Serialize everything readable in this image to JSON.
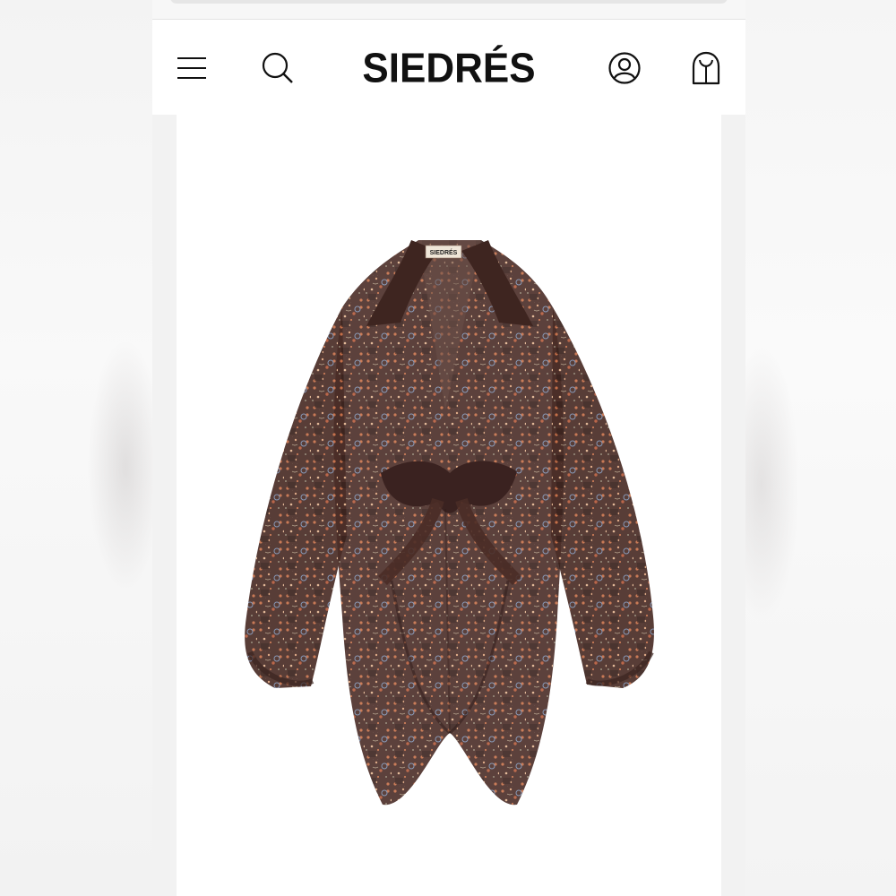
{
  "brand": {
    "name": "SIEDRÉS",
    "label_tag": "SIEDRÉS"
  },
  "header": {
    "icons": [
      "menu-icon",
      "search-icon",
      "account-icon",
      "shopping-bag-icon"
    ]
  },
  "product": {
    "image": "sheer-brown-floral-tie-front-shirt"
  },
  "colors": {
    "header_bg": "#ffffff",
    "logo": "#111111",
    "page_bg": "#f2f2f2",
    "fabric_dark": "#3a2420",
    "fabric_print": "#b8633f"
  }
}
